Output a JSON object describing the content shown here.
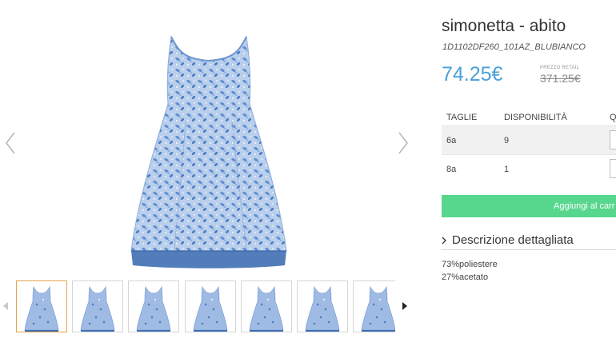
{
  "gallery": {
    "prev_icon": "chevron-left-icon",
    "next_icon": "chevron-right-icon",
    "thumb_prev_icon": "triangle-left-icon",
    "thumb_next_icon": "triangle-right-icon",
    "thumbnail_count": 7,
    "active_thumbnail": 1
  },
  "product": {
    "title": "simonetta - abito",
    "sku": "1D1102DF260_101AZ_BLUBIANCO",
    "price": "74.25€",
    "retail_label": "PREZZO RETAIL",
    "retail_price": "371.25€"
  },
  "sizes": {
    "headers": {
      "size": "TAGLIE",
      "availability": "DISPONIBILITÀ",
      "quantity": "Q"
    },
    "rows": [
      {
        "size": "6a",
        "availability": "9"
      },
      {
        "size": "8a",
        "availability": "1"
      }
    ]
  },
  "cart": {
    "label": "Aggiungi al carr"
  },
  "description": {
    "toggle_label": "Descrizione dettagliata",
    "toggle_icon": "chevron-right-icon",
    "composition": [
      "73%poliestere",
      "27%acetato"
    ]
  },
  "colors": {
    "price": "#4aa0d9",
    "cart_button": "#57d68d",
    "active_thumb_border": "#e3a34e",
    "dress_base": "#a9c3e6",
    "dress_hem": "#3f6fb2"
  }
}
